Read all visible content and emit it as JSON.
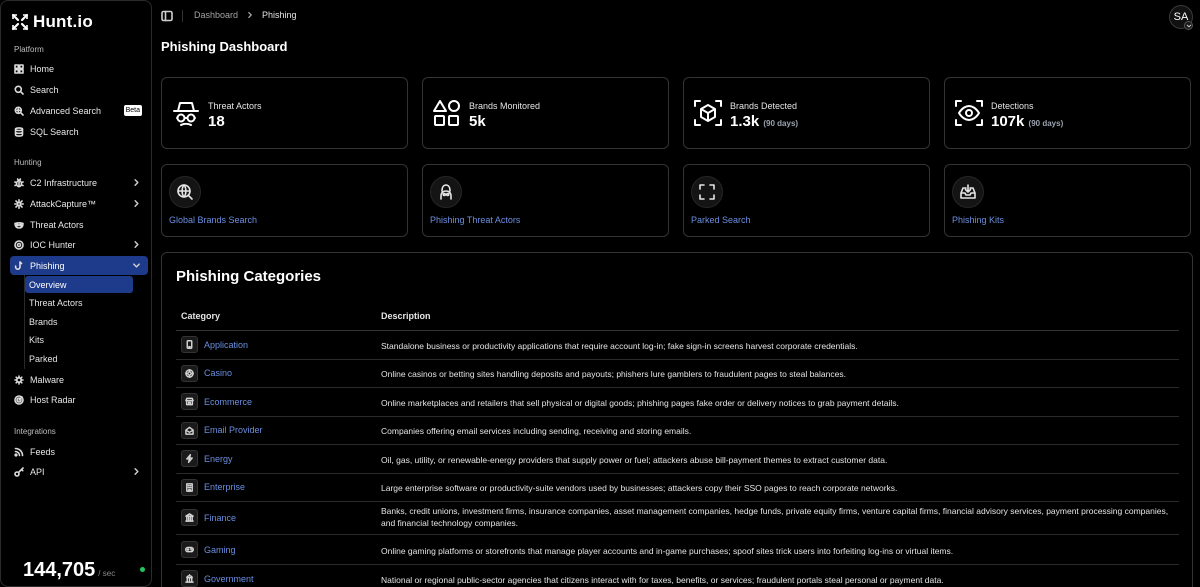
{
  "brand": {
    "name": "Hunt.io"
  },
  "sidebar": {
    "sections": {
      "platform": "Platform",
      "hunting": "Hunting",
      "integrations": "Integrations"
    },
    "platform_items": [
      {
        "label": "Home",
        "icon": "home-icon"
      },
      {
        "label": "Search",
        "icon": "search-icon"
      },
      {
        "label": "Advanced Search",
        "icon": "sparkle-search-icon",
        "badge": "Beta"
      },
      {
        "label": "SQL Search",
        "icon": "database-icon"
      }
    ],
    "hunting_items": [
      {
        "label": "C2 Infrastructure",
        "icon": "bug-icon"
      },
      {
        "label": "AttackCapture™",
        "icon": "gear-icon"
      },
      {
        "label": "Threat Actors",
        "icon": "mask-icon"
      },
      {
        "label": "IOC Hunter",
        "icon": "radar-icon"
      },
      {
        "label": "Phishing",
        "icon": "fishhook-icon"
      }
    ],
    "phishing_sub": [
      "Overview",
      "Threat Actors",
      "Brands",
      "Kits",
      "Parked"
    ],
    "more_items": [
      {
        "label": "Malware",
        "icon": "malware-icon"
      },
      {
        "label": "Host Radar",
        "icon": "radar-icon"
      }
    ],
    "integration_items": [
      {
        "label": "Feeds",
        "icon": "rss-icon"
      },
      {
        "label": "API",
        "icon": "key-icon"
      }
    ],
    "counter": {
      "value": "144,705",
      "unit": "/ sec"
    }
  },
  "header": {
    "breadcrumb": [
      "Dashboard",
      "Phishing"
    ],
    "avatar_initials": "SA"
  },
  "page": {
    "title": "Phishing Dashboard"
  },
  "stats": [
    {
      "label": "Threat Actors",
      "value": "18",
      "sub": "",
      "icon": "spy-icon"
    },
    {
      "label": "Brands Monitored",
      "value": "5k",
      "sub": "",
      "icon": "shapes-icon"
    },
    {
      "label": "Brands Detected",
      "value": "1.3k",
      "sub": "(90 days)",
      "icon": "box-scan-icon"
    },
    {
      "label": "Detections",
      "value": "107k",
      "sub": "(90 days)",
      "icon": "eye-scan-icon"
    }
  ],
  "links": [
    {
      "label": "Global Brands Search",
      "icon": "globe-search-icon"
    },
    {
      "label": "Phishing Threat Actors",
      "icon": "hacker-icon"
    },
    {
      "label": "Parked Search",
      "icon": "frame-icon"
    },
    {
      "label": "Phishing Kits",
      "icon": "tray-download-icon"
    }
  ],
  "categories": {
    "title": "Phishing Categories",
    "columns": [
      "Category",
      "Description"
    ],
    "rows": [
      {
        "name": "Application",
        "icon": "phone-icon",
        "desc": "Standalone business or productivity applications that require account log-in; fake sign-in screens harvest corporate credentials."
      },
      {
        "name": "Casino",
        "icon": "chip-icon",
        "desc": "Online casinos or betting sites handling deposits and payouts; phishers lure gamblers to fraudulent pages to steal balances."
      },
      {
        "name": "Ecommerce",
        "icon": "store-icon",
        "desc": "Online marketplaces and retailers that sell physical or digital goods; phishing pages fake order or delivery notices to grab payment details."
      },
      {
        "name": "Email Provider",
        "icon": "mail-open-icon",
        "desc": "Companies offering email services including sending, receiving and storing emails."
      },
      {
        "name": "Energy",
        "icon": "bolt-icon",
        "desc": "Oil, gas, utility, or renewable-energy providers that supply power or fuel; attackers abuse bill-payment themes to extract customer data."
      },
      {
        "name": "Enterprise",
        "icon": "building-icon",
        "desc": "Large enterprise software or productivity-suite vendors used by businesses; attackers copy their SSO pages to reach corporate networks."
      },
      {
        "name": "Finance",
        "icon": "bank-icon",
        "desc": "Banks, credit unions, investment firms, insurance companies, asset management companies, hedge funds, private equity firms, venture capital firms, financial advisory services, payment processing companies, and financial technology companies."
      },
      {
        "name": "Gaming",
        "icon": "gamepad-icon",
        "desc": "Online gaming platforms or storefronts that manage player accounts and in-game purchases; spoof sites trick users into forfeiting log-ins or virtual items."
      },
      {
        "name": "Government",
        "icon": "capitol-icon",
        "desc": "National or regional public-sector agencies that citizens interact with for taxes, benefits, or services; fraudulent portals steal personal or payment data."
      }
    ]
  }
}
